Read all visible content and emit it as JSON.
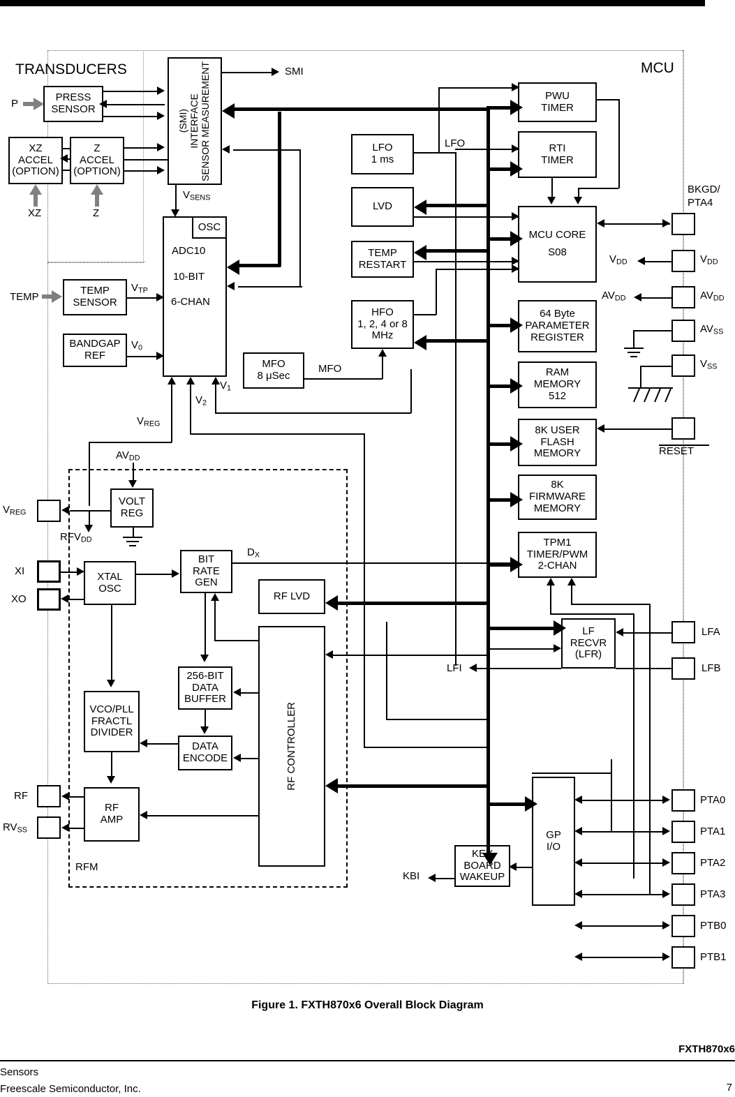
{
  "figure": {
    "caption": "Figure 1. FXTH870x6 Overall Block Diagram",
    "part_number": "FXTH870x6"
  },
  "footer": {
    "left_line1": "Sensors",
    "left_line2": "Freescale Semiconductor, Inc.",
    "page_number": "7"
  },
  "regions": {
    "transducers_label": "TRANSDUCERS",
    "mcu_label": "MCU",
    "rfm_label": "RFM"
  },
  "transducers": {
    "press_sensor": "PRESS\nSENSOR",
    "press_sensor_l1": "PRESS",
    "press_sensor_l2": "SENSOR",
    "xz_accel_l1": "XZ",
    "xz_accel_l2": "ACCEL",
    "xz_accel_l3": "(OPTION)",
    "z_accel_l1": "Z",
    "z_accel_l2": "ACCEL",
    "z_accel_l3": "(OPTION)",
    "input_p": "P",
    "input_xz": "XZ",
    "input_z": "Z",
    "input_temp": "TEMP"
  },
  "analog": {
    "smi_label": "SENSOR MEASUREMENT INTERFACE (SMI)",
    "smi_l1": "SENSOR MEASUREMENT",
    "smi_l2": "INTERFACE",
    "smi_l3": "(SMI)",
    "smi_output": "SMI",
    "vsens": "V",
    "vsens_sub": "SENS",
    "adc_osc": "OSC",
    "adc_l1": "ADC10",
    "adc_l2": "10-BIT",
    "adc_l3": "6-CHAN",
    "temp_sensor_l1": "TEMP",
    "temp_sensor_l2": "SENSOR",
    "bandgap_l1": "BANDGAP",
    "bandgap_l2": "REF",
    "vtp": "V",
    "vtp_sub": "TP",
    "v0": "V",
    "v0_sub": "0",
    "v1": "V",
    "v1_sub": "1",
    "v2": "V",
    "v2_sub": "2",
    "vreg": "V",
    "vreg_sub": "REG"
  },
  "clocks": {
    "lfo_l1": "LFO",
    "lfo_l2": "1 ms",
    "lfo_signal": "LFO",
    "lvd": "LVD",
    "temp_restart_l1": "TEMP",
    "temp_restart_l2": "RESTART",
    "hfo_l1": "HFO",
    "hfo_l2": "1, 2, 4 or 8",
    "hfo_l3": "MHz",
    "mfo_l1": "MFO",
    "mfo_l2": "8 μSec",
    "mfo_signal": "MFO"
  },
  "mcu": {
    "pwu_timer_l1": "PWU",
    "pwu_timer_l2": "TIMER",
    "rti_timer_l1": "RTI",
    "rti_timer_l2": "TIMER",
    "core_l1": "MCU CORE",
    "core_l2": "S08",
    "param_reg_l1": "64 Byte",
    "param_reg_l2": "PARAMETER",
    "param_reg_l3": "REGISTER",
    "ram_l1": "RAM",
    "ram_l2": "MEMORY",
    "ram_l3": "512",
    "flash_l1": "8K USER",
    "flash_l2": "FLASH",
    "flash_l3": "MEMORY",
    "firmware_l1": "8K",
    "firmware_l2": "FIRMWARE",
    "firmware_l3": "MEMORY",
    "tpm1_l1": "TPM1",
    "tpm1_l2": "TIMER/PWM",
    "tpm1_l3": "2-CHAN",
    "lfr_l1": "LF",
    "lfr_l2": "RECVR",
    "lfr_l3": "(LFR)",
    "lfi_signal": "LFI",
    "gpio_l1": "GP",
    "gpio_l2": "I/O",
    "kbw_l1": "KEY",
    "kbw_l2": "BOARD",
    "kbw_l3": "WAKEUP",
    "kbi_signal": "KBI"
  },
  "pins": {
    "bkgd_l1": "BKGD/",
    "bkgd_l2": "PTA4",
    "vdd": "V",
    "vdd_sub": "DD",
    "avdd": "AV",
    "avdd_sub": "DD",
    "avss": "AV",
    "avss_sub": "SS",
    "vss": "V",
    "vss_sub": "SS",
    "reset": "RESET",
    "lfa": "LFA",
    "lfb": "LFB",
    "pta0": "PTA0",
    "pta1": "PTA1",
    "pta2": "PTA2",
    "pta3": "PTA3",
    "ptb0": "PTB0",
    "ptb1": "PTB1",
    "vreg_pin": "V",
    "vreg_pin_sub": "REG",
    "xi": "XI",
    "xo": "XO",
    "rf": "RF",
    "rvss": "RV",
    "rvss_sub": "SS"
  },
  "rfm": {
    "volt_reg_l1": "VOLT",
    "volt_reg_l2": "REG",
    "avdd_in": "AV",
    "avdd_in_sub": "DD",
    "rfvdd": "RFV",
    "rfvdd_sub": "DD",
    "xtal_osc_l1": "XTAL",
    "xtal_osc_l2": "OSC",
    "bit_rate_l1": "BIT",
    "bit_rate_l2": "RATE",
    "bit_rate_l3": "GEN",
    "dx_signal": "D",
    "dx_signal_sub": "X",
    "rf_lvd": "RF LVD",
    "vco_l1": "VCO/PLL",
    "vco_l2": "FRACTL",
    "vco_l3": "DIVIDER",
    "data_buffer_l1": "256-BIT",
    "data_buffer_l2": "DATA",
    "data_buffer_l3": "BUFFER",
    "data_encode_l1": "DATA",
    "data_encode_l2": "ENCODE",
    "rf_amp_l1": "RF",
    "rf_amp_l2": "AMP",
    "rf_controller": "RF CONTROLLER"
  },
  "colors": {
    "line": "#000000",
    "gray_arrow": "#808080",
    "dotted_border": "#666666",
    "background": "#ffffff"
  }
}
